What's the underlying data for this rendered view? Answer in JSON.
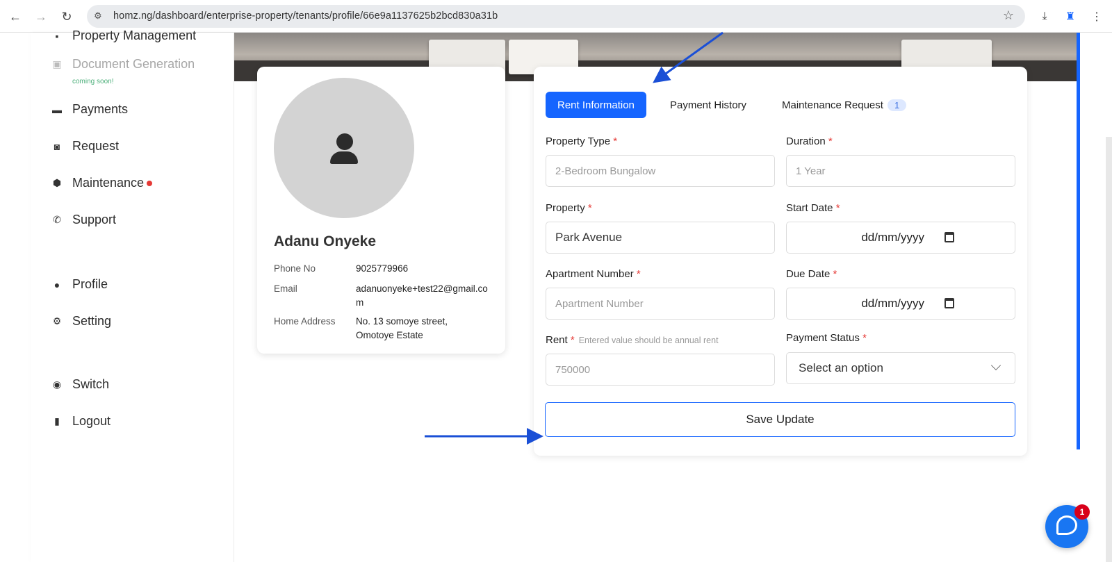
{
  "browser": {
    "url": "homz.ng/dashboard/enterprise-property/tenants/profile/66e9a1137625b2bcd830a31b"
  },
  "sidebar": {
    "items": [
      {
        "label": "Property Management",
        "icon": "building-icon"
      },
      {
        "label": "Document Generation",
        "icon": "document-icon",
        "note": "coming soon!"
      },
      {
        "label": "Payments",
        "icon": "card-icon"
      },
      {
        "label": "Request",
        "icon": "request-icon"
      },
      {
        "label": "Maintenance",
        "icon": "maintenance-icon"
      },
      {
        "label": "Support",
        "icon": "phone-icon"
      },
      {
        "label": "Profile",
        "icon": "user-icon"
      },
      {
        "label": "Setting",
        "icon": "gear-icon"
      },
      {
        "label": "Switch",
        "icon": "switch-icon"
      },
      {
        "label": "Logout",
        "icon": "logout-icon"
      }
    ]
  },
  "profile": {
    "name": "Adanu Onyeke",
    "phone_label": "Phone No",
    "phone": "9025779966",
    "email_label": "Email",
    "email": "adanuonyeke+test22@gmail.com",
    "address_label": "Home Address",
    "address": "No. 13 somoye street, Omotoye Estate"
  },
  "tabs": {
    "rent": "Rent Information",
    "payment": "Payment History",
    "maintenance": "Maintenance Request",
    "maintenance_count": "1"
  },
  "form": {
    "property_type_label": "Property Type",
    "property_type_placeholder": "2-Bedroom Bungalow",
    "duration_label": "Duration",
    "duration_placeholder": "1 Year",
    "property_label": "Property",
    "property_value": "Park Avenue",
    "start_date_label": "Start Date",
    "start_date_value": "dd/mm/yyyy",
    "apartment_label": "Apartment Number",
    "apartment_placeholder": "Apartment Number",
    "due_date_label": "Due Date",
    "due_date_value": "dd/mm/yyyy",
    "rent_label": "Rent",
    "rent_hint": "Entered value should be annual rent",
    "rent_placeholder": "750000",
    "payment_status_label": "Payment Status",
    "payment_status_value": "Select an option",
    "required_mark": "*",
    "save_label": "Save Update"
  },
  "chat": {
    "badge": "1"
  },
  "colors": {
    "accent": "#1565ff",
    "required": "#e53935",
    "annotation_arrow": "#1a4fd6"
  }
}
